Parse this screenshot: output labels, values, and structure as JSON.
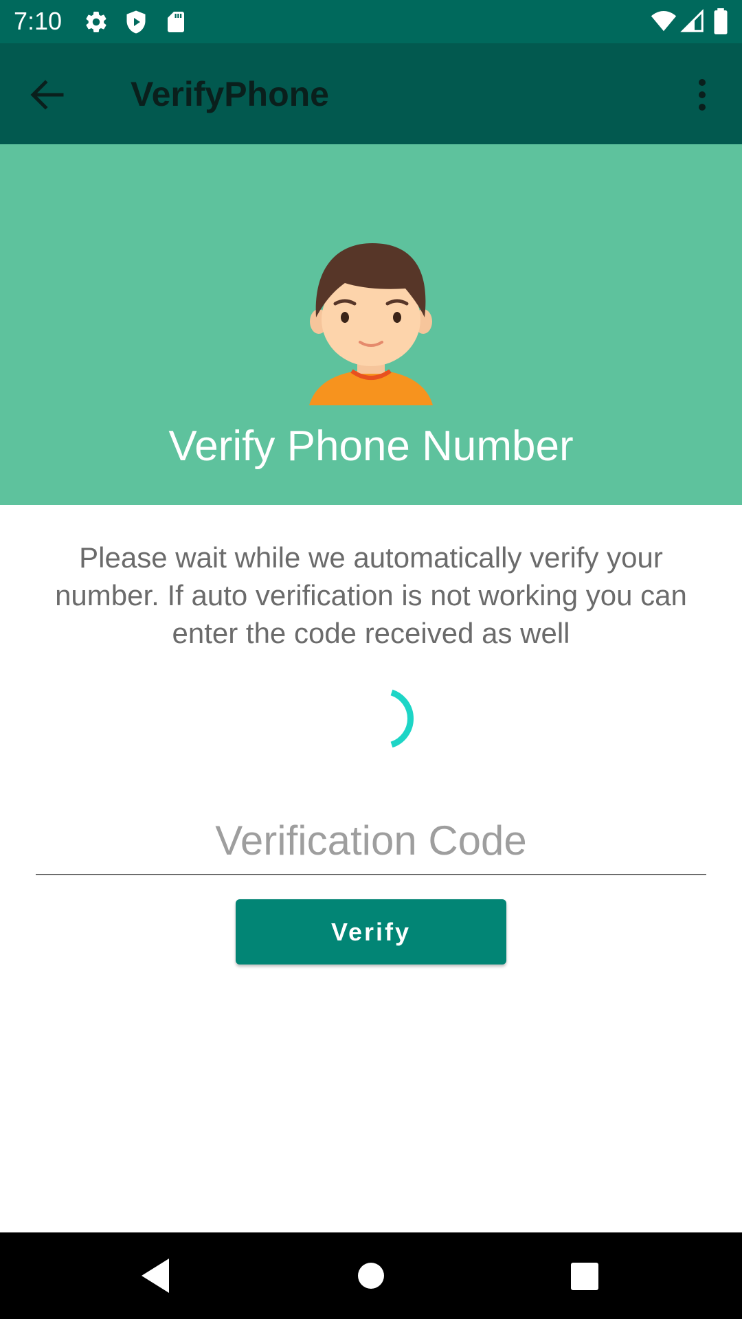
{
  "status_bar": {
    "time": "7:10",
    "left_icons": [
      "gear-icon",
      "shield-play-icon",
      "sd-card-icon"
    ],
    "right_icons": [
      "wifi-icon",
      "cell-signal-icon",
      "battery-icon"
    ]
  },
  "app_bar": {
    "title": "VerifyPhone",
    "back_icon": "arrow-back-icon",
    "menu_icon": "overflow-menu-icon"
  },
  "header": {
    "title": "Verify Phone Number",
    "avatar_icon": "user-avatar-icon"
  },
  "instructions": "Please wait while we automatically verify your number. If auto verification is not working you can enter the code received as well",
  "code_input": {
    "value": "",
    "placeholder": "Verification Code"
  },
  "verify_button": {
    "label": "Verify"
  },
  "nav_bar": {
    "icons": [
      "back-triangle-icon",
      "home-circle-icon",
      "recents-square-icon"
    ]
  },
  "colors": {
    "status_bar": "#00695c",
    "app_bar": "#02594f",
    "header": "#5ec29d",
    "button": "#028575",
    "spinner": "#1dd5c6"
  }
}
